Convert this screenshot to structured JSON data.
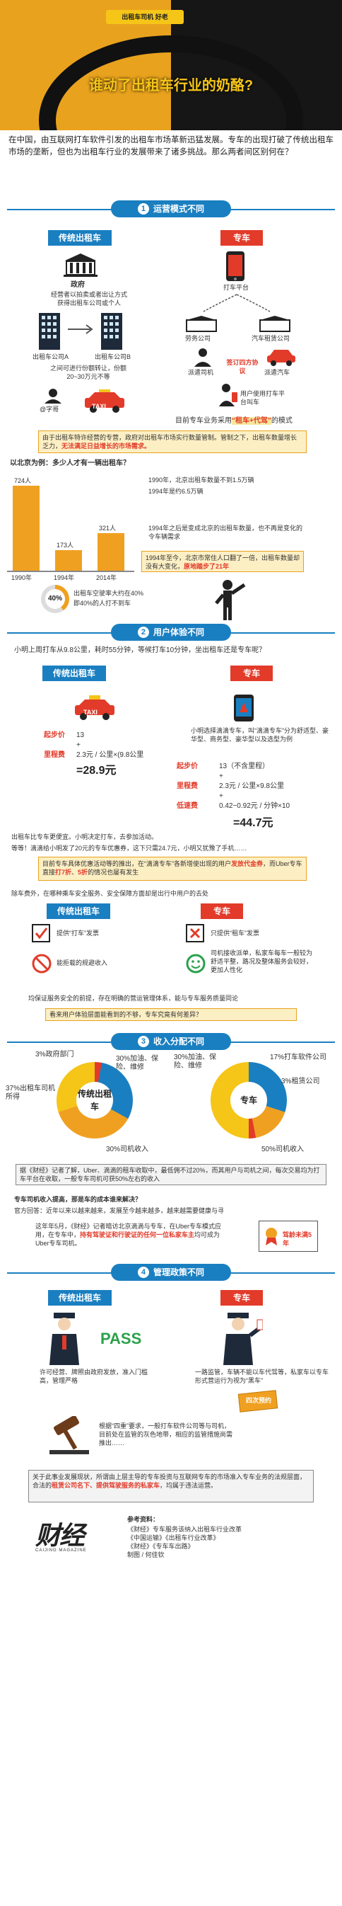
{
  "header": {
    "sign": "出租车司机 好老",
    "title": "谁动了出租车行业的奶酪?"
  },
  "intro": "在中国，由互联网打车软件引发的出租车市场革新迅猛发展。专车的出现打破了传统出租车市场的垄断，但也为出租车行业的发展带来了诸多挑战。那么两者间区别何在？",
  "sec1": {
    "num": "1",
    "title": "运营模式不同",
    "left_tag": "传统出租车",
    "right_tag": "专车",
    "gov": "政府",
    "gov_note": "经营者以拍卖或者出让方式获得出租车公司或个人",
    "company_a": "出租车公司A",
    "company_b": "出租车公司B",
    "company_note": "之间可进行份额转让，份额20~30万元不等",
    "driver_label": "@字哥",
    "taxi_label": "TAXI",
    "platform": "打车平台",
    "labor": "劳务公司",
    "rental": "汽车租赁公司",
    "driver_hire": "派遣司机",
    "car_hire": "派遣汽车",
    "four_party": "签订四方协议",
    "user_label": "用户使用打车平台叫车",
    "model_note_a": "目前专车业务采用",
    "model_note_b": "“租车+代驾”",
    "model_note_c": "的模式",
    "summary": "由于出租车特许经营的专营，政府对出租车市场实行数量管制。管制之下，出租车数量增长乏力，",
    "summary_red": "无法满足日益增长的市场需求。"
  },
  "stats": {
    "question": "以北京为例：多少人才有一辆出租车？",
    "bars": [
      {
        "year": "1990年",
        "value": "724人"
      },
      {
        "year": "1994年",
        "value": "173人"
      },
      {
        "year": "2014年",
        "value": "321人"
      }
    ],
    "note1": "1990年，北京出租车数量不到1.5万辆",
    "note2": "1994年是约6.5万辆",
    "note3": "1994年之后是变成北京的出租车数量，也不再是变化的令车辆需求",
    "note4": "1994年至今，北京市常住人口翻了一倍，出租车数量却没有大变化，",
    "note4_red": "原地踏步了21年",
    "pct": "40%",
    "pct_note_1": "出租车空驶率大约在40%",
    "pct_note_2": "即40%的人打不到车"
  },
  "sec2": {
    "num": "2",
    "title": "用户体验不同",
    "question": "小明上周打车从9.8公里，耗时55分钟，等候打车10分钟，坐出租车还是专车呢？",
    "left_tag": "传统出租车",
    "right_tag": "专车",
    "taxi_label": "TAXI",
    "taxi_start_k": "起步价",
    "taxi_start_v": "13",
    "taxi_mile_k": "里程费",
    "taxi_mile_v": "2.3元 / 公里×(9.8公里",
    "taxi_total": "=28.9元",
    "car_desc": "小明选择滴滴专车，叫“滴滴专车”分为舒适型、豪华型、商务型、豪华型以及选型为例",
    "car_start_k": "起步价",
    "car_start_v": "13（不含里程）",
    "car_mile_k": "里程费",
    "car_mile_v": "2.3元 / 公里×9.8公里",
    "car_low_k": "低速费",
    "car_low_v": "0.42~0.92元 / 分钟×10",
    "car_total": "=44.7元",
    "compare_1": "出租车比专车更便宜。小明决定打车，去参加活动。",
    "compare_2": "等等！滴滴给小明发了20元的专车优惠券，这下只需24.7元，小明又犹豫了手机……",
    "promo_1": "目前专车具体优惠活动等的推出，在“滴滴专车”各新增使出现的用户",
    "promo_red1": "发放代金券",
    "promo_2": "，而Uber专车直接",
    "promo_red2": "打7折",
    "promo_3": "、",
    "promo_red3": "5折",
    "promo_4": "的情况也屡有发生",
    "safety_q": "除车费外，在哪种乘车安全服务、安全保障方面却是出行中用户的去处",
    "left_tag2": "传统出租车",
    "right_tag2": "专车",
    "taxi_safe_1": "提供“打车”发票",
    "taxi_safe_2": "能拒载的规避收入",
    "car_safe_1": "只提供“租车”发票",
    "car_safe_2": "司机接收派单，私家车每车一般较为舒适平整，路况及整体服务会较好，更加人性化",
    "safety_note": "均保证服务安全的前提，存在明确的营运管理体系，能与专车服务质量同论",
    "safety_q2": "看来用户体验层面能看到的不够，专车究竟有何差异？"
  },
  "sec3": {
    "num": "3",
    "title": "收入分配不同",
    "taxi_center": "传统出租车",
    "car_center": "专车",
    "taxi_pcts": [
      {
        "label": "3%政府部门",
        "pct": 3,
        "color": "#e23b2a"
      },
      {
        "label": "30%加油、保险、维修",
        "pct": 30,
        "color": "#1a7fc1"
      },
      {
        "label": "37%出租车司机所得",
        "pct": 37,
        "color": "#f0a020"
      },
      {
        "label": "30%司机收入",
        "pct": 30,
        "color": "#f5c518"
      }
    ],
    "car_pcts": [
      {
        "label": "30%加油、保险、维修",
        "pct": 30,
        "color": "#1a7fc1"
      },
      {
        "label": "17%打车软件公司",
        "pct": 17,
        "color": "#f0a020"
      },
      {
        "label": "3%租赁公司",
        "pct": 3,
        "color": "#e23b2a"
      },
      {
        "label": "50%司机收入",
        "pct": 50,
        "color": "#f5c518"
      }
    ],
    "note": "据《财经》记者了解，Uber、滴滴的租车收取中，最低佣不过20%，而其用户与司机之间，每次交易均为打车平台在收取，一般专车司机可获50%左右的收入",
    "qa_q": "专车司机收入提高，那是车的成本谁来解决？",
    "qa_a": "官方回答：近年以来以越来越来，发展至今越来越多，越来越需要健康与寻",
    "sub_1": "这年年5月，《财经》记者暗访北京滴滴与专车，在Uber专车模式应用，在专车中，",
    "sub_red": "持有驾驶证和行驶证的任何一位私家车主",
    "sub_2": "均可成为Uber专车司机。",
    "badge": "驾龄未满5年"
  },
  "sec4": {
    "num": "4",
    "title": "管理政策不同",
    "left_tag": "传统出租车",
    "right_tag": "专车",
    "pass": "PASS",
    "taxi_mgmt": "许可经营、牌照由政府发放，准入门槛高，管理严格",
    "car_mgmt": "一路监管，车辆不能以车代驾等，私家车以专车形式营运行为视为“黑车”",
    "sign": "四次预约",
    "warn": "根据“四重”要求，一般打车软件公司等与司机，目前处在监管的灰色地带，相应的监管措施尚需推出……",
    "final_1": "关于此事业发展现状，所谓由上层主导的专车投资与互联网专车的市场准入专车业务的法规层面，合法的",
    "final_red1": "租赁公司名下、提供驾驶服务的私家车",
    "final_2": "，均属于违法运营。"
  },
  "footer": {
    "logo": "财经",
    "logo_sub": "CAIJING MAGAZINE",
    "ref_title": "参考资料：",
    "refs": [
      "《财经》专车服务该纳入出租车行业改革",
      "《中国运输》《出租车行业改革》",
      "《财经》《专车车出路》"
    ],
    "credit": "制图 / 何佳钦"
  }
}
